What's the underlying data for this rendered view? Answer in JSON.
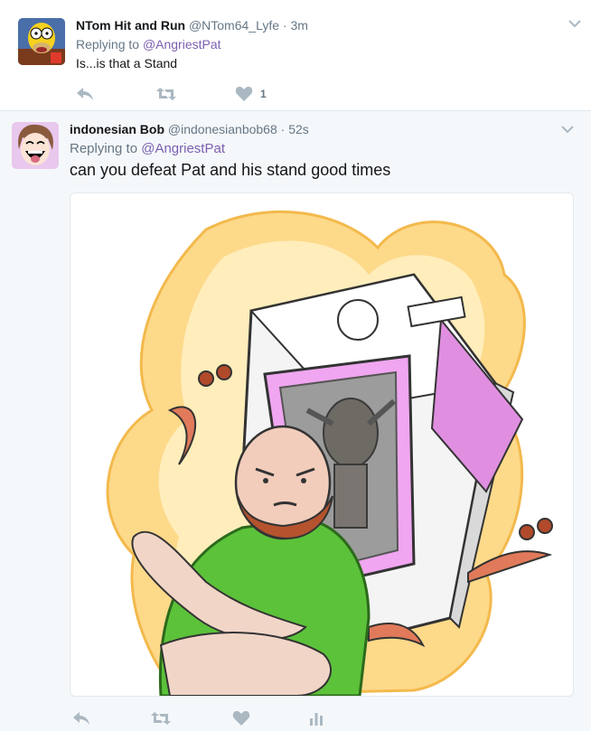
{
  "tweets": [
    {
      "name": "NTom Hit and Run",
      "handle": "@NTom64_Lyfe",
      "separator": "·",
      "time": "3m",
      "replying_prefix": "Replying to",
      "replying_to": "@AngriestPat",
      "text": "Is...is that a Stand",
      "like_count": "1",
      "avatar_icon": "cartoon-character-avatar"
    },
    {
      "name": "indonesian Bob",
      "handle": "@indonesianbob68",
      "separator": "·",
      "time": "52s",
      "replying_prefix": "Replying to",
      "replying_to": "@AngriestPat",
      "text": "can you defeat Pat and his stand good times",
      "avatar_icon": "laughing-cartoon-avatar",
      "media_description_icon": "illustration-bearded-man-with-stand-in-box"
    }
  ],
  "colors": {
    "link": "#7b5fb1",
    "muted": "#657786",
    "icon": "#aab8c2",
    "selected_bg": "#f5f8fa"
  }
}
